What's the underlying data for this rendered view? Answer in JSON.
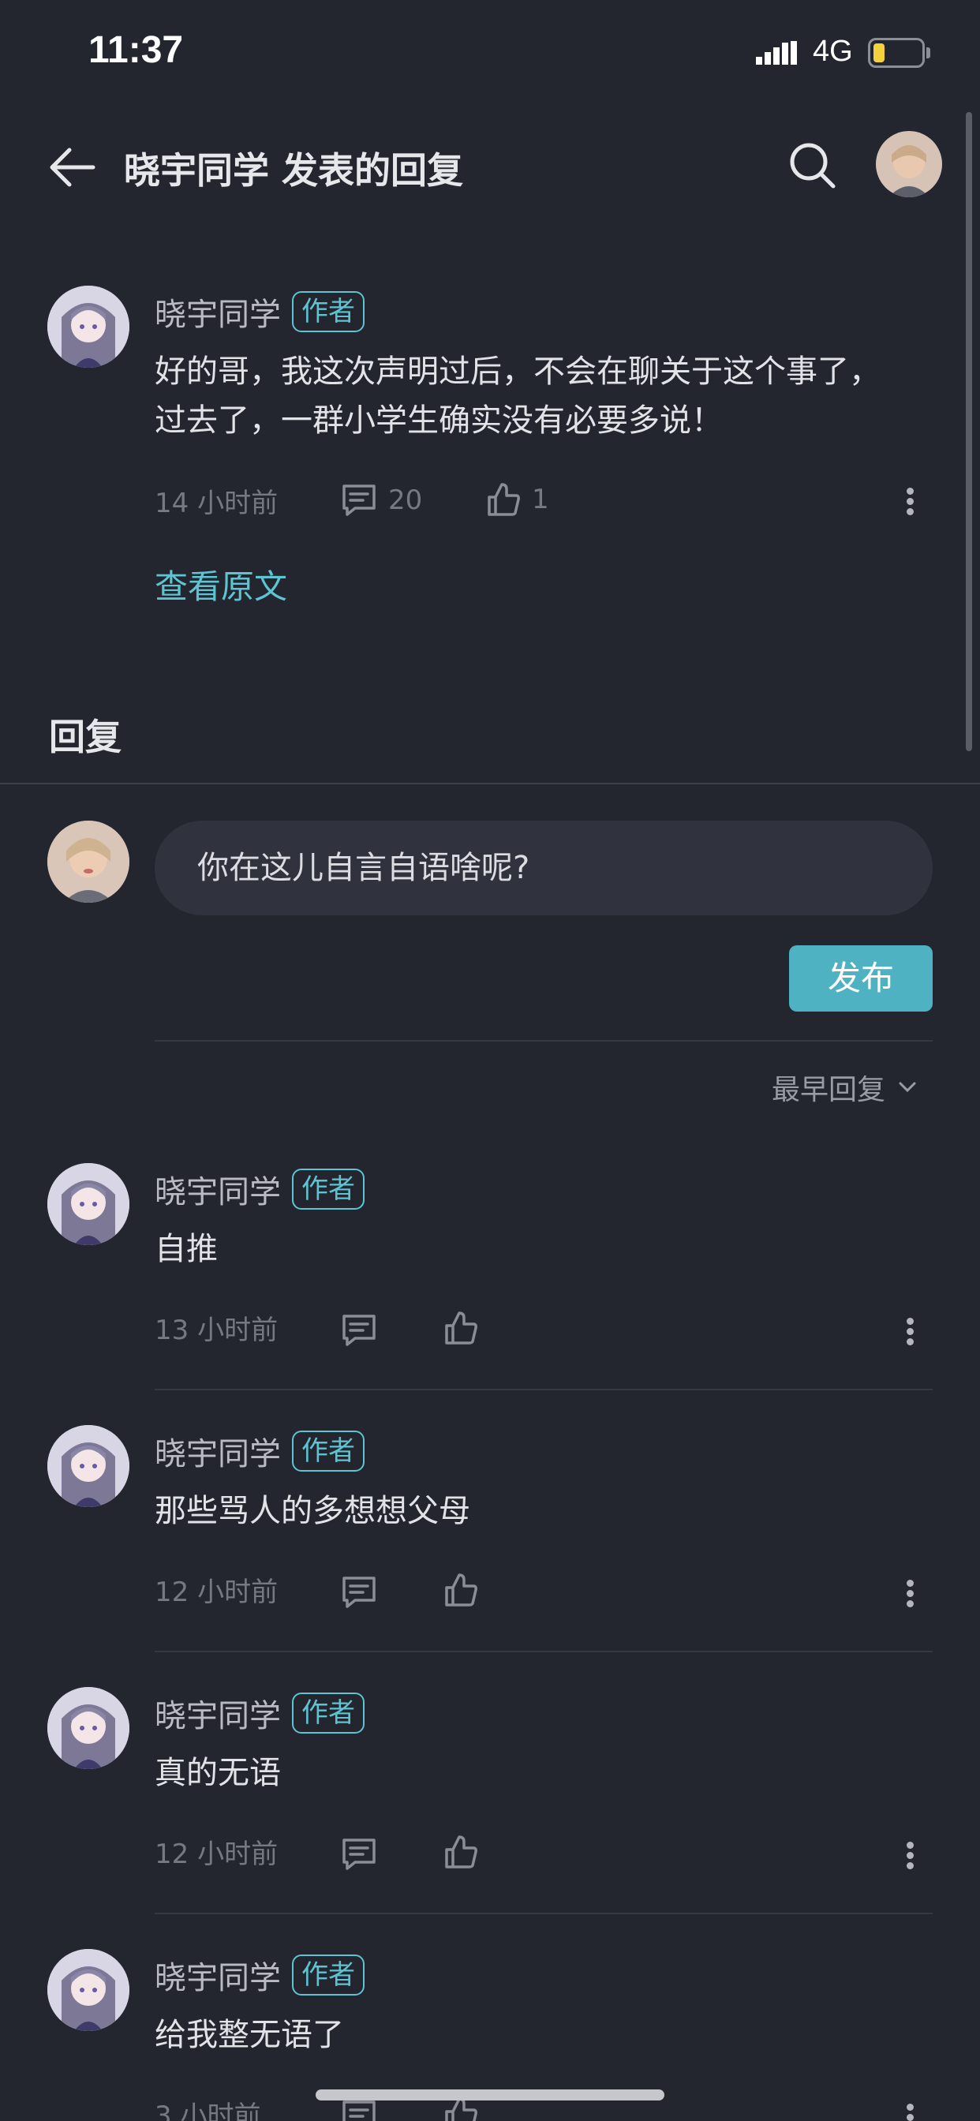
{
  "status_bar": {
    "time": "11:37",
    "network": "4G"
  },
  "header": {
    "title": "晓宇同学 发表的回复"
  },
  "original_post": {
    "username": "晓宇同学",
    "badge": "作者",
    "content_line1": "好的哥，我这次声明过后，不会在聊关于这个事了，",
    "content_line2": "过去了，一群小学生确实没有必要多说！",
    "time": "14 小时前",
    "comments": "20",
    "likes": "1",
    "view_original": "查看原文"
  },
  "reply_section": {
    "title": "回复",
    "input_value": "你在这儿自言自语啥呢?",
    "publish_label": "发布",
    "sort_label": "最早回复"
  },
  "replies": [
    {
      "username": "晓宇同学",
      "badge": "作者",
      "content": "自推",
      "time": "13 小时前"
    },
    {
      "username": "晓宇同学",
      "badge": "作者",
      "content": "那些骂人的多想想父母",
      "time": "12 小时前"
    },
    {
      "username": "晓宇同学",
      "badge": "作者",
      "content": "真的无语",
      "time": "12 小时前"
    },
    {
      "username": "晓宇同学",
      "badge": "作者",
      "content": "给我整无语了",
      "time": "3 小时前"
    }
  ],
  "colors": {
    "background": "#23252f",
    "accent": "#5ec4d1",
    "button": "#4eb2c2"
  }
}
